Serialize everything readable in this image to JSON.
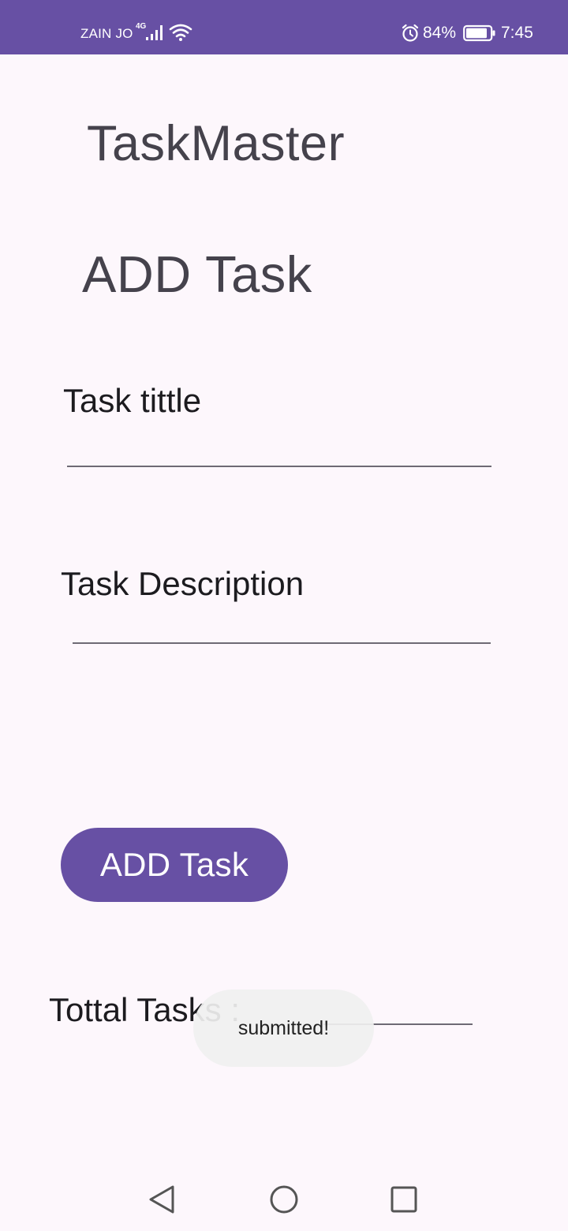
{
  "status_bar": {
    "carrier": "ZAIN JO",
    "network_type": "4G",
    "battery_percent": "84%",
    "time": "7:45",
    "background_color": "#6750a4",
    "icons": [
      "signal-icon",
      "wifi-icon",
      "alarm-icon",
      "battery-icon"
    ]
  },
  "app": {
    "title": "TaskMaster",
    "heading": "ADD Task"
  },
  "form": {
    "title_label": "Task tittle",
    "title_value": "",
    "description_label": "Task Description",
    "description_value": "",
    "submit_label": "ADD Task",
    "accent_color": "#6750a4"
  },
  "summary": {
    "total_label": "Tottal Tasks :"
  },
  "toast": {
    "message": "submitted!"
  },
  "nav_bar": {
    "icons": [
      "back-icon",
      "home-icon",
      "recent-apps-icon"
    ]
  }
}
